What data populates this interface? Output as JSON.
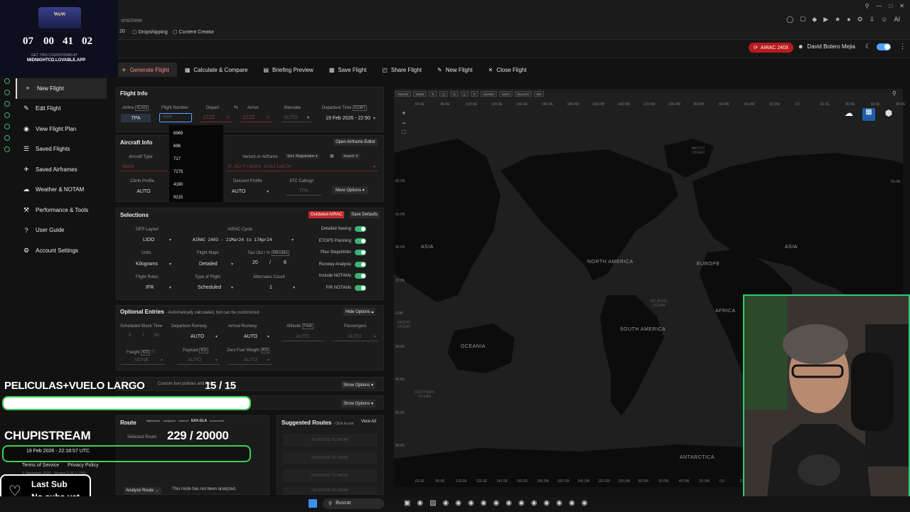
{
  "browser": {
    "url": "ons/new",
    "bookmarks": [
      "20",
      "Dropshipping",
      "Content Creator"
    ]
  },
  "app": {
    "airac_badge": "AIRAC 2403",
    "user_name": "David Botero Mejia"
  },
  "toolbar": [
    {
      "label": "Generate Flight",
      "icon": "plane-icon"
    },
    {
      "label": "Calculate & Compare",
      "icon": "calculator-icon"
    },
    {
      "label": "Briefing Preview",
      "icon": "document-icon"
    },
    {
      "label": "Save Flight",
      "icon": "save-icon"
    },
    {
      "label": "Share Flight",
      "icon": "share-icon"
    },
    {
      "label": "New Flight",
      "icon": "edit-icon"
    },
    {
      "label": "Close Flight",
      "icon": "close-icon"
    }
  ],
  "sidebar": [
    {
      "label": "New Flight",
      "icon": "plus-icon"
    },
    {
      "label": "Edit Flight",
      "icon": "pencil-icon"
    },
    {
      "label": "View Flight Plan",
      "icon": "eye-icon"
    },
    {
      "label": "Saved Flights",
      "icon": "list-icon"
    },
    {
      "label": "Saved Airframes",
      "icon": "plane-icon"
    },
    {
      "label": "Weather & NOTAM",
      "icon": "cloud-icon"
    },
    {
      "label": "Performance & Tools",
      "icon": "tools-icon"
    },
    {
      "label": "User Guide",
      "icon": "question-icon"
    },
    {
      "label": "Account Settings",
      "icon": "gear-icon"
    }
  ],
  "flight_info": {
    "title": "Flight Info",
    "labels": {
      "airline": "Airline",
      "airline_tag": "ICAO",
      "flight_number": "Flight Number",
      "depart": "Depart",
      "arrive": "Arrive",
      "alternate": "Alternate",
      "dep_time": "Departure Time",
      "dep_time_tag": "EOBT"
    },
    "airline": "TPA",
    "flight_number_placeholder": "0000",
    "depart": "ZZZZ",
    "arrive": "ZZZZ",
    "alternate": "AUTO",
    "departure_time": "19 Feb 2026 - 22:50",
    "suggestions": [
      "6969",
      "696",
      "717",
      "7275",
      "4180",
      "9215"
    ]
  },
  "aircraft_info": {
    "title": "Aircraft Info",
    "open_editor": "Open Airframe Editor",
    "aircraft_type_label": "Aircraft Type",
    "aircraft_type_value": "None",
    "variant_label": "Variant or Airframe",
    "sort": "Sort: Registration",
    "search": "Search",
    "airframes_available": "0 Airframes Available",
    "climb_label": "Climb Profile",
    "climb_value": "AUTO",
    "descent_label": "Descent Profile",
    "descent_value": "AUTO",
    "atc_label": "ATC Callsign",
    "atc_value": "TPA",
    "more_options": "More Options"
  },
  "selections": {
    "title": "Selections",
    "outdated": "Outdated AIRAC",
    "save_defaults": "Save Defaults",
    "ofp_layout_label": "OFP Layout",
    "ofp_layout": "LIDO",
    "airac_label": "AIRAC Cycle",
    "airac": "AIRAC 2403 - 21Mar24 to 17Apr24",
    "units_label": "Units",
    "units": "Kilograms",
    "maps_label": "Flight Maps",
    "maps": "Detailed",
    "taxi_label": "Taxi Out / In",
    "taxi_tag": "Minutes",
    "taxi_out": "20",
    "taxi_in": "8",
    "rules_label": "Flight Rules",
    "rules": "IFR",
    "type_label": "Type of Flight",
    "type": "Scheduled",
    "alternates_label": "Alternates Count",
    "alternates": "1",
    "toggles": [
      "Detailed Navlog",
      "ETOPS Planning",
      "Plan Stepclimbs",
      "Runway Analysis",
      "Include NOTAMs",
      "FIR NOTAMs"
    ]
  },
  "optional": {
    "title": "Optional Entries",
    "subtitle": "- Automatically calculated, but can be customized",
    "hide": "Hide Options",
    "block_time_label": "Scheduled Block Time",
    "block_h": "0",
    "block_m": "00",
    "dep_rwy_label": "Departure Runway",
    "dep_rwy": "AUTO",
    "arr_rwy_label": "Arrival Runway",
    "arr_rwy": "AUTO",
    "altitude_label": "Altitude",
    "altitude_tag": "Feet",
    "altitude": "AUTO",
    "pax_label": "Passengers",
    "pax": "AUTO",
    "freight_label": "Freight",
    "freight_tag": "KG",
    "freight": "NONE",
    "payload_label": "Payload",
    "payload_tag": "KG",
    "payload": "AUTO",
    "zfw_label": "Zero Fuel Weight",
    "zfw_tag": "KG",
    "zfw": "AUTO"
  },
  "fuel": {
    "subtitle": "Custom fuel policies and fuel",
    "show1": "Show Options",
    "show2": "Show Options"
  },
  "route": {
    "title": "Route",
    "selected_label": "Selected Route",
    "analyze": "Analyze Route",
    "analysis_status": "This route has not been analyzed.",
    "suggested_title": "Suggested Routes",
    "suggested_sub": "- Click to use",
    "view_all": "View All",
    "no_route": "NO ROUTE TO SHOW",
    "providers": [
      "flightaware",
      "navigraph",
      "simbrief",
      "EXX-GLA",
      "eurocontrol"
    ]
  },
  "footer": {
    "terms": "Terms of Service",
    "privacy": "Privacy Policy",
    "copyright": "© Navigraph 2026 - Version 2.26.1 (759)"
  },
  "map": {
    "toolbar": [
      "ROUTE",
      "GRPS",
      "WX/SAT",
      "NATS",
      "PACOTS",
      "FIR"
    ],
    "labels": {
      "north_america": "NORTH AMERICA",
      "south_america": "SOUTH AMERICA",
      "europe": "EUROPE",
      "africa": "AFRICA",
      "asia_w": "ASIA",
      "asia_e": "ASIA",
      "oceania": "OCEANIA",
      "antarctica": "ANTARCTICA"
    },
    "oceans": {
      "arctic": "ARCTIC OCEAN",
      "atlantic": "ATLANTIC OCEAN",
      "pacific": "PACIFIC OCEAN",
      "southern": "SOUTHERN OCEAN"
    },
    "lon_ticks": [
      "60.0E",
      "80.0E",
      "100.0E",
      "120.0E",
      "140.0E",
      "160.0E",
      "180.0W",
      "160.0W",
      "140.0W",
      "120.0W",
      "100.0W",
      "80.0W",
      "60.0W",
      "40.0W",
      "20.0W",
      "0.0",
      "20.0E",
      "40.0E",
      "60.0E",
      "80.0E"
    ],
    "lat_ticks_left": [
      "80.0N",
      "60.0N",
      "40.0N",
      "20.0N",
      "0.0N",
      "20.0S",
      "40.0S",
      "60.0S",
      "80.0S"
    ],
    "lat_tick_right": "60.0N"
  },
  "overlay": {
    "countdown": [
      "07",
      "00",
      "41",
      "02"
    ],
    "countdown_caption": "GET THIS COUNTDOWN AT",
    "countdown_url": "MIDNIGHTCD.LOVABLE.APP",
    "goal1_title": "PELICULAS+VUELO LARGO",
    "goal1_count": "15",
    "goal1_total": "/ 15",
    "goal1_progress": 1.0,
    "goal2_title": "CHUPISTREAM",
    "goal2_count": "229",
    "goal2_total": "/ 20000",
    "goal2_date": "19 Feb 2026 - 22:18:57 UTC",
    "last_sub_title": "Last Sub",
    "last_sub_text": "No subs yet"
  },
  "taskbar": {
    "search": "Buscar"
  }
}
